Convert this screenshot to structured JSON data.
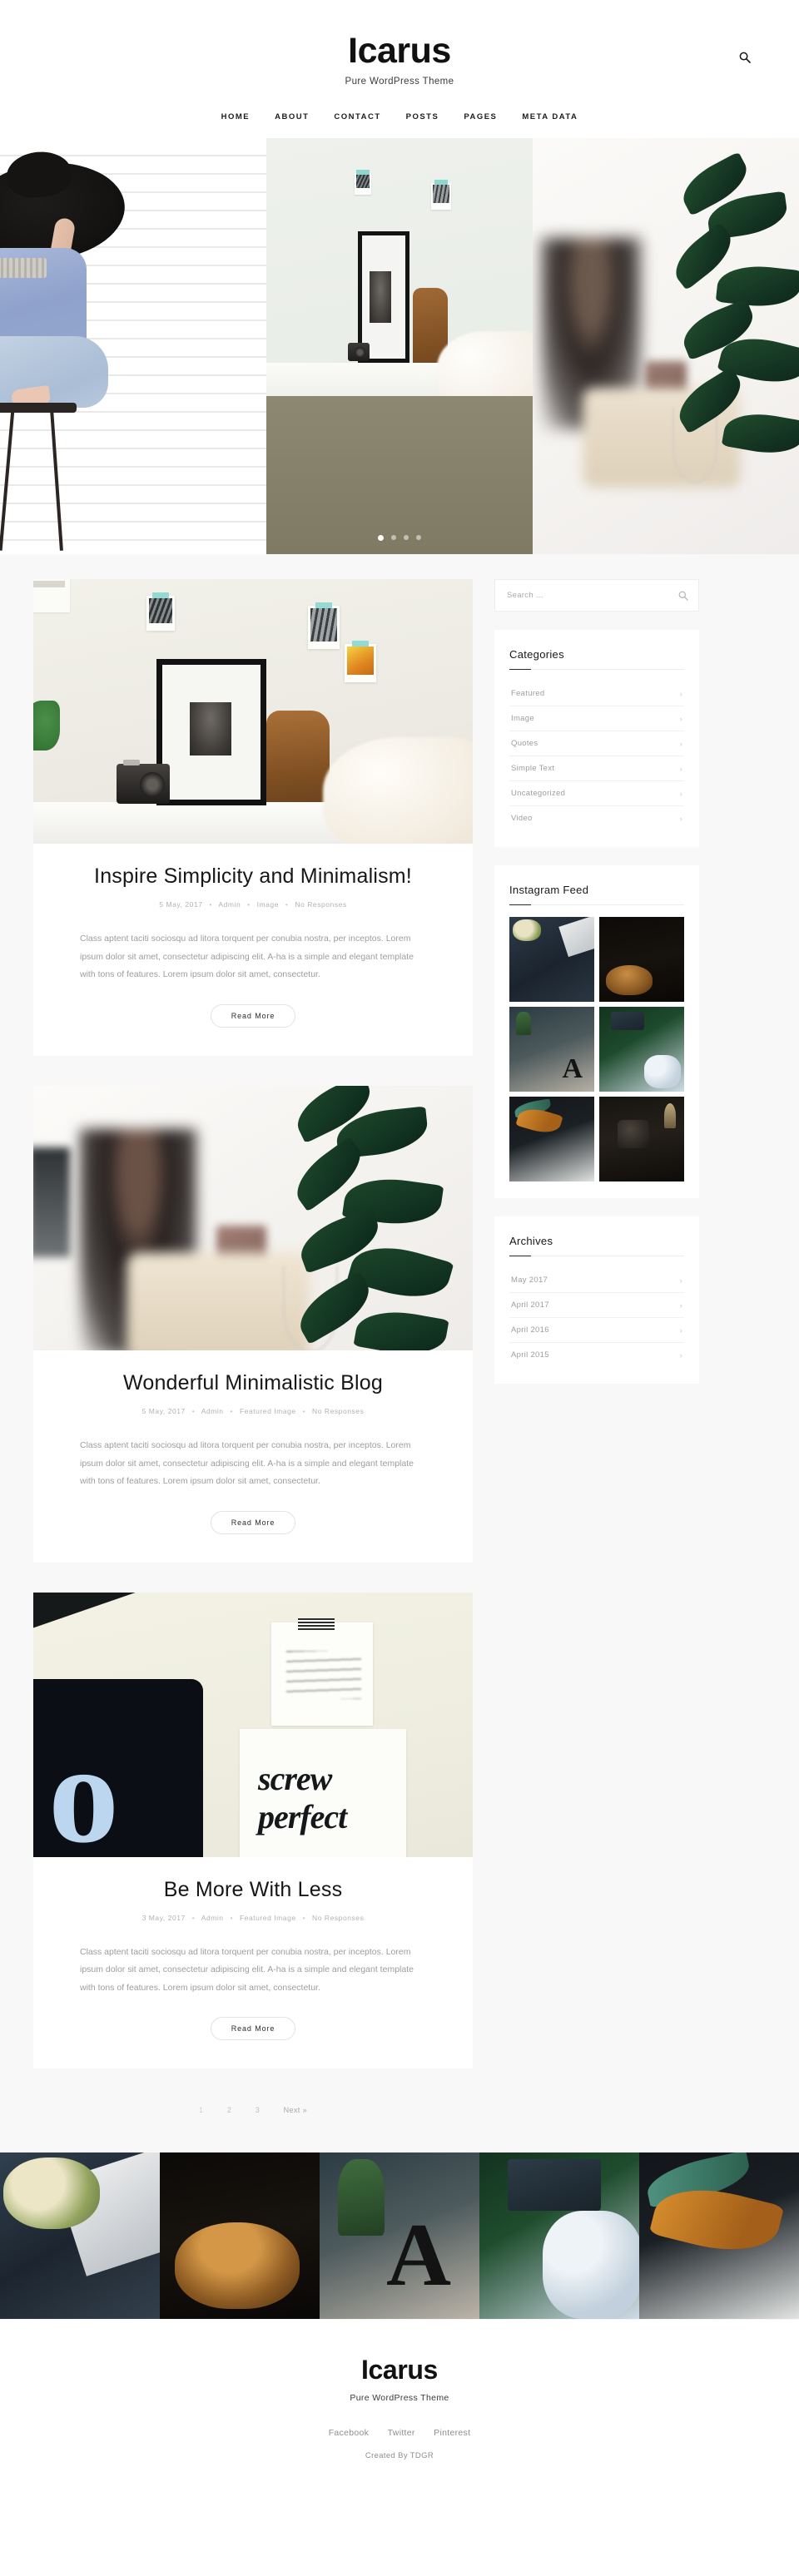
{
  "header": {
    "site_title": "Icarus",
    "tagline": "Pure WordPress Theme",
    "search_icon": "search-icon",
    "nav": [
      {
        "label": "HOME"
      },
      {
        "label": "ABOUT"
      },
      {
        "label": "CONTACT"
      },
      {
        "label": "POSTS"
      },
      {
        "label": "PAGES"
      },
      {
        "label": "META DATA"
      }
    ]
  },
  "hero": {
    "slides": [
      {
        "alt": "Woman wearing a wide black hat sitting on a stool against white plank wall"
      },
      {
        "alt": "Black framed print and vintage camera on white desk"
      },
      {
        "alt": "Blurred figure at a table with green plant in foreground"
      }
    ],
    "dots": [
      {
        "active": true
      },
      {
        "active": false
      },
      {
        "active": false
      },
      {
        "active": false
      }
    ]
  },
  "posts": [
    {
      "title": "Inspire Simplicity and Minimalism!",
      "date": "5 May, 2017",
      "author": "Admin",
      "category": "Image",
      "comments": "No Responses",
      "excerpt": "Class aptent taciti sociosqu ad litora torquent per conubia nostra, per inceptos. Lorem ipsum dolor sit amet, consectetur adipiscing elit. A-ha is a simple and elegant template with tons of features. Lorem ipsum dolor sit amet, consectetur.",
      "read_more": "Read More",
      "image_alt": "Framed photograph and vintage camera on a white desk"
    },
    {
      "title": "Wonderful Minimalistic Blog",
      "date": "5 May, 2017",
      "author": "Admin",
      "category": "Featured Image",
      "comments": "No Responses",
      "excerpt": "Class aptent taciti sociosqu ad litora torquent per conubia nostra, per inceptos. Lorem ipsum dolor sit amet, consectetur adipiscing elit. A-ha is a simple and elegant template with tons of features. Lorem ipsum dolor sit amet, consectetur.",
      "read_more": "Read More",
      "image_alt": "Blurred woman at a table with a green plant in the foreground"
    },
    {
      "title": "Be More With Less",
      "date": "3 May, 2017",
      "author": "Admin",
      "category": "Featured Image",
      "comments": "No Responses",
      "excerpt": "Class aptent taciti sociosqu ad litora torquent per conubia nostra, per inceptos. Lorem ipsum dolor sit amet, consectetur adipiscing elit. A-ha is a simple and elegant template with tons of features. Lorem ipsum dolor sit amet, consectetur.",
      "read_more": "Read More",
      "image_alt": "Desk flatlay with tablet and hand lettered prints"
    }
  ],
  "pagination": {
    "pages": [
      {
        "label": "1",
        "current": true
      },
      {
        "label": "2",
        "current": false
      },
      {
        "label": "3",
        "current": false
      }
    ],
    "next_label": "Next »"
  },
  "sidebar": {
    "search": {
      "placeholder": "Search ...",
      "value": "",
      "icon": "search-icon"
    },
    "categories": {
      "title": "Categories",
      "items": [
        {
          "label": "Featured"
        },
        {
          "label": "Image"
        },
        {
          "label": "Quotes"
        },
        {
          "label": "Simple Text"
        },
        {
          "label": "Uncategorized"
        },
        {
          "label": "Video"
        }
      ]
    },
    "instagram": {
      "title": "Instagram Feed",
      "images": [
        {
          "alt": "Laptop with white roses on dark denim cloth"
        },
        {
          "alt": "Rustic sourdough loaf on dark background"
        },
        {
          "alt": "Letter A sculpture on a floor by a window"
        },
        {
          "alt": "Hand over tablet with green and blue knit blankets"
        },
        {
          "alt": "Orange and green tropical leaves on dark surface"
        },
        {
          "alt": "Dark vintage stove with dried wheat"
        }
      ]
    },
    "archives": {
      "title": "Archives",
      "items": [
        {
          "label": "May 2017"
        },
        {
          "label": "April 2017"
        },
        {
          "label": "April 2016"
        },
        {
          "label": "April 2015"
        }
      ]
    },
    "chevron": "›"
  },
  "footer_instagram": {
    "images": [
      {
        "alt": "Laptop with white roses on dark denim cloth"
      },
      {
        "alt": "Rustic sourdough loaf on dark background"
      },
      {
        "alt": "Letter A sculpture on a floor by a window"
      },
      {
        "alt": "Hand over tablet with green and blue knit blankets"
      },
      {
        "alt": "Orange and green tropical leaves on dark surface"
      }
    ]
  },
  "footer": {
    "title": "Icarus",
    "tagline": "Pure WordPress Theme",
    "social": [
      {
        "label": "Facebook"
      },
      {
        "label": "Twitter"
      },
      {
        "label": "Pinterest"
      }
    ],
    "credit": "Created By TDGR"
  },
  "colors": {
    "accent": "#2a2a2a",
    "page_bg": "#f8f8f8",
    "card_bg": "#ffffff",
    "text_dark": "#171717",
    "text_muted": "#9d9d9d"
  }
}
